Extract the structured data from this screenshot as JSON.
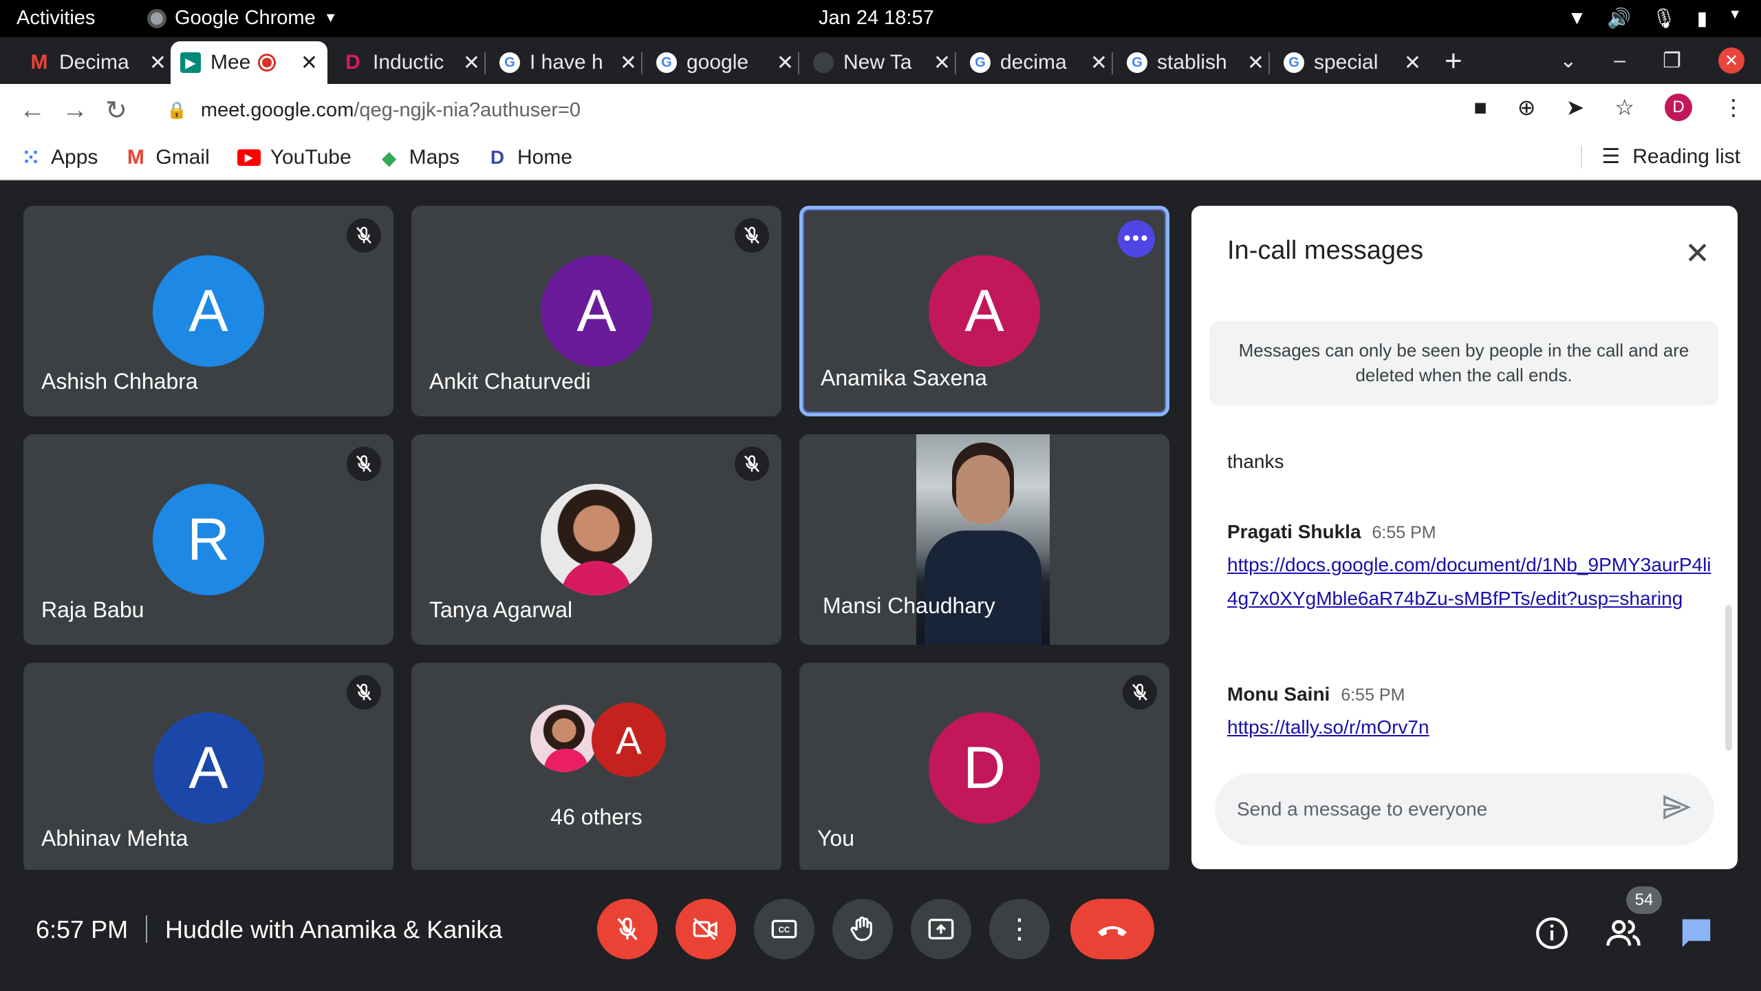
{
  "system": {
    "activities": "Activities",
    "app_name": "Google Chrome",
    "clock": "Jan 24  18:57"
  },
  "tabs": [
    {
      "label": "Decima",
      "icon": "gmail-icon",
      "color": "#ea4335"
    },
    {
      "label": "Mee",
      "icon": "meet-icon",
      "color": "#00897b",
      "active": true
    },
    {
      "label": "Inductic",
      "icon": "home-d-icon",
      "color": "#d81b60"
    },
    {
      "label": "I have h",
      "icon": "google-icon",
      "color": "#4285f4"
    },
    {
      "label": "google",
      "icon": "google-icon",
      "color": "#4285f4"
    },
    {
      "label": "New Ta",
      "icon": "newtab-icon",
      "color": "#5f6368"
    },
    {
      "label": "decima",
      "icon": "google-icon",
      "color": "#4285f4"
    },
    {
      "label": "stablish",
      "icon": "google-icon",
      "color": "#4285f4"
    },
    {
      "label": "special",
      "icon": "google-icon",
      "color": "#4285f4"
    }
  ],
  "omnibox": {
    "host": "meet.google.com",
    "path": "/qeg-ngjk-nia?authuser=0"
  },
  "profile_initial": "D",
  "bookmarks": {
    "apps": "Apps",
    "gmail": "Gmail",
    "youtube": "YouTube",
    "maps": "Maps",
    "home": "Home",
    "reading_list": "Reading list"
  },
  "participants": [
    {
      "name": "Ashish Chhabra",
      "initial": "A",
      "color": "#1e88e5",
      "muted": true
    },
    {
      "name": "Ankit Chaturvedi",
      "initial": "A",
      "color": "#6a1b9a",
      "muted": true
    },
    {
      "name": "Anamika Saxena",
      "initial": "A",
      "color": "#c2185b",
      "speaking": true
    },
    {
      "name": "Raja Babu",
      "initial": "R",
      "color": "#1e88e5",
      "muted": true
    },
    {
      "name": "Tanya Agarwal",
      "photo": true,
      "muted": true
    },
    {
      "name": "Mansi Chaudhary",
      "video": true
    },
    {
      "name": "Abhinav Mehta",
      "initial": "A",
      "color": "#1a47a8",
      "muted": true
    },
    {
      "others_label": "46 others",
      "initial": "A"
    },
    {
      "name": "You",
      "initial": "D",
      "color": "#c2185b",
      "muted": true
    }
  ],
  "chat": {
    "title": "In-call messages",
    "notice": "Messages can only be seen by people in the call and are deleted when the call ends.",
    "messages": [
      {
        "text": "thanks"
      },
      {
        "sender": "Pragati Shukla",
        "time": "6:55 PM",
        "link": "https://docs.google.com/document/d/1Nb_9PMY3aurP4li4g7x0XYgMble6aR74bZu-sMBfPTs/edit?usp=sharing"
      },
      {
        "sender": "Monu Saini",
        "time": "6:55 PM",
        "link": "https://tally.so/r/mOrv7n"
      }
    ],
    "placeholder": "Send a message to everyone"
  },
  "bottom": {
    "time": "6:57 PM",
    "meeting_title": "Huddle with Anamika & Kanika",
    "participant_count": "54"
  },
  "colors": {
    "background": "#202124",
    "tile": "#3c4043",
    "red": "#ea4335",
    "chat_icon": "#8ab4f8"
  }
}
